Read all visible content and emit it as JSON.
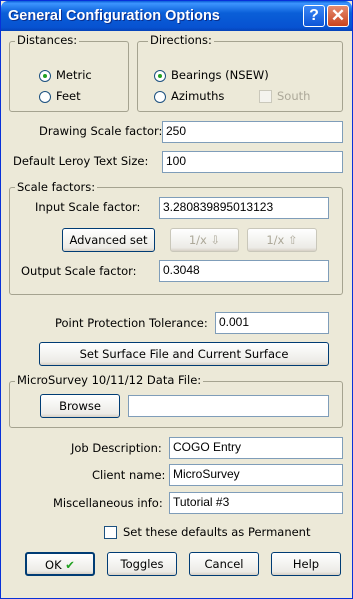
{
  "window": {
    "title": "General Configuration Options",
    "help_glyph": "?",
    "close_glyph": "✕"
  },
  "distances": {
    "legend": "Distances:",
    "options": [
      {
        "label": "Metric",
        "selected": true
      },
      {
        "label": "Feet",
        "selected": false
      }
    ]
  },
  "directions": {
    "legend": "Directions:",
    "options": [
      {
        "label": "Bearings (NSEW)",
        "selected": true
      },
      {
        "label": "Azimuths",
        "selected": false
      }
    ],
    "south_label": "South",
    "south_checked": false,
    "south_enabled": false
  },
  "drawing_scale": {
    "label": "Drawing Scale factor:",
    "value": "250"
  },
  "leroy_text": {
    "label": "Default Leroy Text Size:",
    "value": "100"
  },
  "scale_factors": {
    "legend": "Scale factors:",
    "input_label": "Input Scale factor:",
    "input_value": "3.280839895013123",
    "advanced_button": "Advanced set",
    "down_button": "1/x ⇩",
    "up_button": "1/x ⇧",
    "output_label": "Output Scale factor:",
    "output_value": "0.3048"
  },
  "point_protection": {
    "label": "Point Protection Tolerance:",
    "value": "0.001"
  },
  "surface_button": "Set Surface File and Current Surface",
  "data_file": {
    "legend": "MicroSurvey 10/11/12 Data File:",
    "browse_button": "Browse",
    "value": ""
  },
  "job_description": {
    "label": "Job Description:",
    "value": "COGO Entry"
  },
  "client_name": {
    "label": "Client name:",
    "value": "MicroSurvey"
  },
  "misc_info": {
    "label": "Miscellaneous info:",
    "value": "Tutorial #3"
  },
  "permanent": {
    "label": "Set these defaults as Permanent",
    "checked": false
  },
  "buttons": {
    "ok": "OK",
    "ok_tick": "✔",
    "toggles": "Toggles",
    "cancel": "Cancel",
    "help": "Help"
  },
  "colors": {
    "titlebar": "#0A5FD8",
    "dialog_bg": "#ECE9D8",
    "ok_tick": "#1FA01F"
  }
}
